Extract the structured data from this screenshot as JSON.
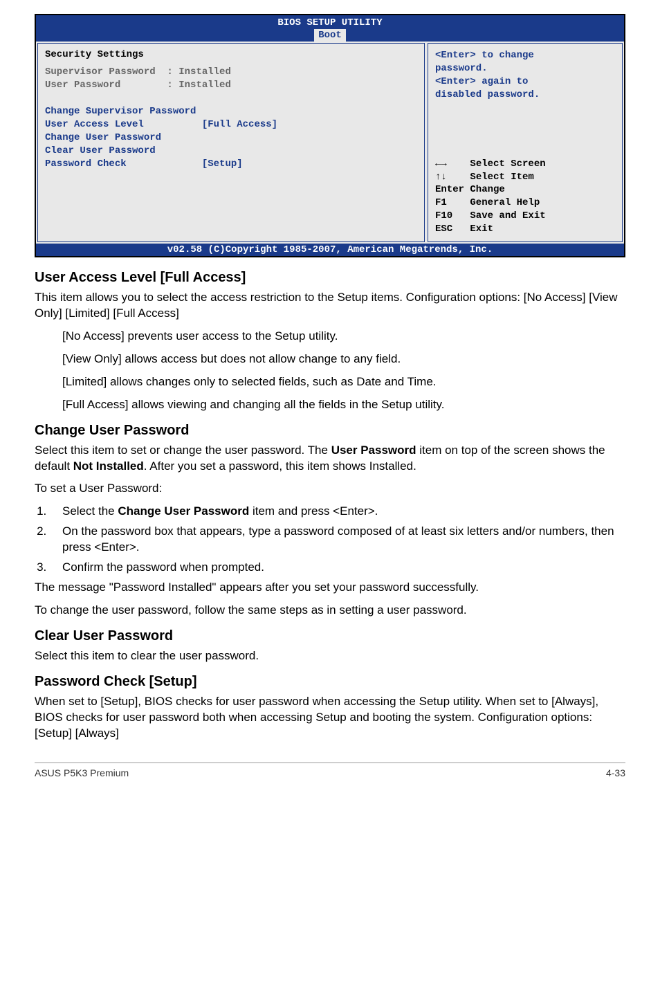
{
  "bios": {
    "headerTitle": "BIOS SETUP UTILITY",
    "tab": "Boot",
    "panelTitle": "Security Settings",
    "rows": {
      "supLabel": "Supervisor Password  : ",
      "supVal": "Installed",
      "userLabel": "User Password        : ",
      "userVal": "Installed",
      "changeSup": "Change Supervisor Password",
      "ualLabel": "User Access Level",
      "ualVal": "[Full Access]",
      "changeUser": "Change User Password",
      "clearUser": "Clear User Password",
      "pcLabel": "Password Check",
      "pcVal": "[Setup]"
    },
    "help": {
      "l1": "<Enter> to change",
      "l2": "password.",
      "l3": "<Enter> again to",
      "l4": "disabled password."
    },
    "nav": {
      "r1b": "Select Screen",
      "r2b": "Select Item",
      "r3": "Enter Change",
      "r4": "F1    General Help",
      "r5": "F10   Save and Exit",
      "r6": "ESC   Exit"
    },
    "footer": "v02.58 (C)Copyright 1985-2007, American Megatrends, Inc."
  },
  "sections": {
    "ual": {
      "title": "User Access Level [Full Access]",
      "p1": "This item allows you to select the access restriction to the Setup items. Configuration options: [No Access] [View Only] [Limited] [Full Access]",
      "opt1": "[No Access] prevents user access to the Setup utility.",
      "opt2": "[View Only] allows access but does not allow change to any field.",
      "opt3": "[Limited] allows changes only to selected fields, such as Date and Time.",
      "opt4": "[Full Access] allows viewing and changing all the fields in the Setup utility."
    },
    "cup": {
      "title": "Change User Password",
      "p1a": "Select this item to set or change the user password. The ",
      "p1b": "User Password",
      "p1c": " item on top of the screen shows the default ",
      "p1d": "Not Installed",
      "p1e": ". After you set a password, this item shows Installed.",
      "p2": "To set a User Password:",
      "s1a": "Select the ",
      "s1b": "Change User Password",
      "s1c": " item and press <Enter>.",
      "s2": "On the password box that appears, type a password composed of at least six letters and/or numbers, then press <Enter>.",
      "s3": "Confirm the password when prompted.",
      "p3": "The message \"Password Installed\" appears after you set your password successfully.",
      "p4": "To change the user password, follow the same steps as in setting a user password."
    },
    "clup": {
      "title": "Clear User Password",
      "p1": "Select this item to clear the user password."
    },
    "pc": {
      "title": "Password Check [Setup]",
      "p1": "When set to [Setup], BIOS checks for user password when accessing the Setup utility. When set to [Always], BIOS checks for user password both when accessing Setup and booting the system. Configuration options: [Setup] [Always]"
    }
  },
  "footer": {
    "left": "ASUS P5K3 Premium",
    "right": "4-33"
  }
}
